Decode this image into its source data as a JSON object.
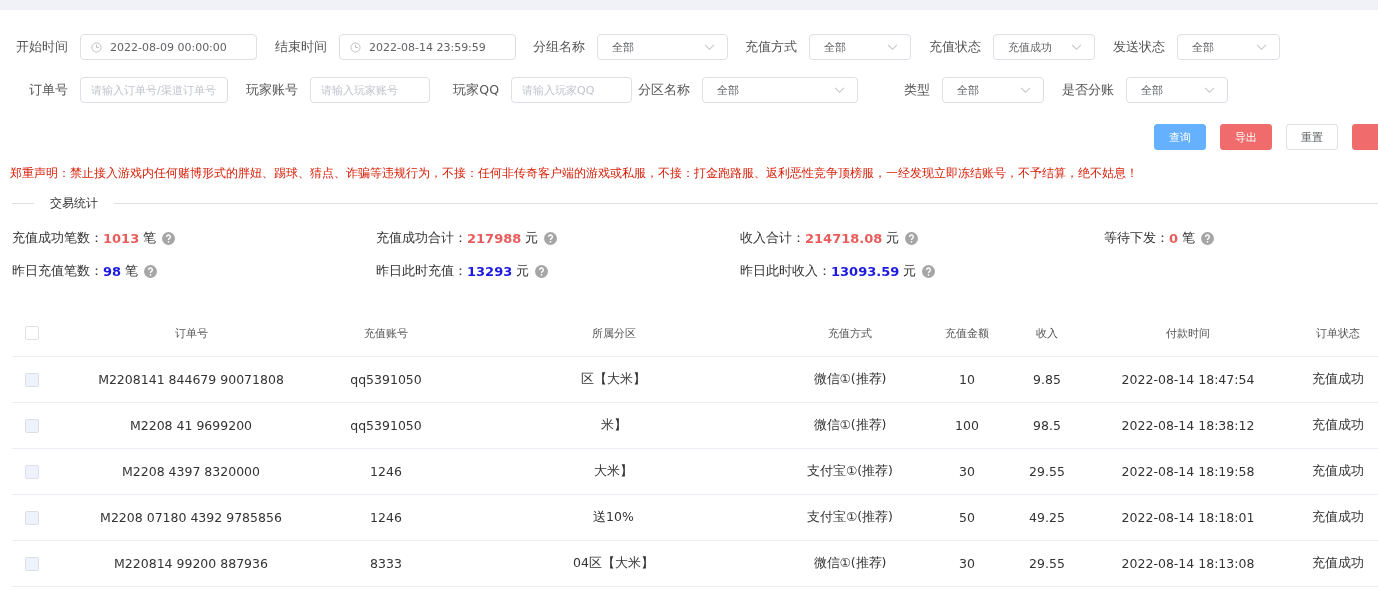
{
  "filters": [
    [
      {
        "kind": "date",
        "label": "开始时间",
        "value": "2022-08-09 00:00:00"
      },
      {
        "kind": "date",
        "label": "结束时间",
        "value": "2022-08-14 23:59:59"
      },
      {
        "kind": "select",
        "label": "分组名称",
        "value": "全部"
      },
      {
        "kind": "select",
        "label": "充值方式",
        "value": "全部"
      },
      {
        "kind": "select",
        "label": "充值状态",
        "value": "充值成功"
      },
      {
        "kind": "select",
        "label": "发送状态",
        "value": "全部"
      }
    ],
    [
      {
        "kind": "text",
        "label": "订单号",
        "placeholder": "请输入订单号/渠道订单号"
      },
      {
        "kind": "text",
        "label": "玩家账号",
        "placeholder": "请输入玩家账号"
      },
      {
        "kind": "text",
        "label": "玩家QQ",
        "placeholder": "请输入玩家QQ"
      },
      {
        "kind": "select",
        "label": "分区名称",
        "value": "全部"
      },
      {
        "kind": "select",
        "label": "类型",
        "value": "全部"
      },
      {
        "kind": "select",
        "label": "是否分账",
        "value": "全部"
      }
    ]
  ],
  "buttons": [
    {
      "kind": "primary",
      "label": "查询"
    },
    {
      "kind": "danger",
      "label": "导出"
    },
    {
      "kind": "default",
      "label": "重置"
    },
    {
      "kind": "danger"
    }
  ],
  "notice": "郑重声明：禁止接入游戏内任何赌博形式的胖妞、踢球、猜点、诈骗等违规行为，不接：任何非传奇客户端的游戏或私服，不接：打金跑路服、返利恶性竞争顶榜服，一经发现立即冻结账号，不予结算，绝不姑息！",
  "stats": {
    "title": "交易统计",
    "items": [
      {
        "label": "充值成功笔数：",
        "value": "1013",
        "unit": "笔",
        "color": "#e85c5c"
      },
      {
        "label": "充值成功合计：",
        "value": "217988",
        "unit": "元",
        "color": "#e85c5c"
      },
      {
        "label": "收入合计：",
        "value": "214718.08",
        "unit": "元",
        "color": "#e85c5c"
      },
      {
        "label": "等待下发：",
        "value": "0",
        "unit": "笔",
        "color": "#e85c5c"
      },
      {
        "label": "昨日充值笔数：",
        "value": "98",
        "unit": "笔",
        "color": "#1a1ae0"
      },
      {
        "label": "昨日此时充值：",
        "value": "13293",
        "unit": "元",
        "color": "#1a1ae0"
      },
      {
        "label": "昨日此时收入：",
        "value": "13093.59",
        "unit": "元",
        "color": "#1a1ae0"
      }
    ]
  },
  "table": {
    "all_checked": false,
    "columns": [
      "订单号",
      "充值账号",
      "所属分区",
      "充值方式",
      "充值金额",
      "收入",
      "付款时间",
      "订单状态"
    ],
    "rows": [
      {
        "checked": false,
        "cells": [
          "M2208141 844679 90071808",
          "qq5391050",
          "区【大米】",
          "微信①(推荐)",
          "10",
          "9.85",
          "2022-08-14 18:47:54",
          "充值成功"
        ]
      },
      {
        "checked": false,
        "cells": [
          "M2208 41 9699200",
          "qq5391050",
          "米】",
          "微信①(推荐)",
          "100",
          "98.5",
          "2022-08-14 18:38:12",
          "充值成功"
        ]
      },
      {
        "checked": false,
        "cells": [
          "M2208 4397 8320000",
          "1246",
          "大米】",
          "支付宝①(推荐)",
          "30",
          "29.55",
          "2022-08-14 18:19:58",
          "充值成功"
        ]
      },
      {
        "checked": false,
        "cells": [
          "M2208 07180 4392 9785856",
          "1246",
          "送10%",
          "支付宝①(推荐)",
          "50",
          "49.25",
          "2022-08-14 18:18:01",
          "充值成功"
        ]
      },
      {
        "checked": false,
        "cells": [
          "M220814 99200 887936",
          "8333",
          "04区【大米】",
          "微信①(推荐)",
          "30",
          "29.55",
          "2022-08-14 18:13:08",
          "充值成功"
        ]
      }
    ]
  }
}
